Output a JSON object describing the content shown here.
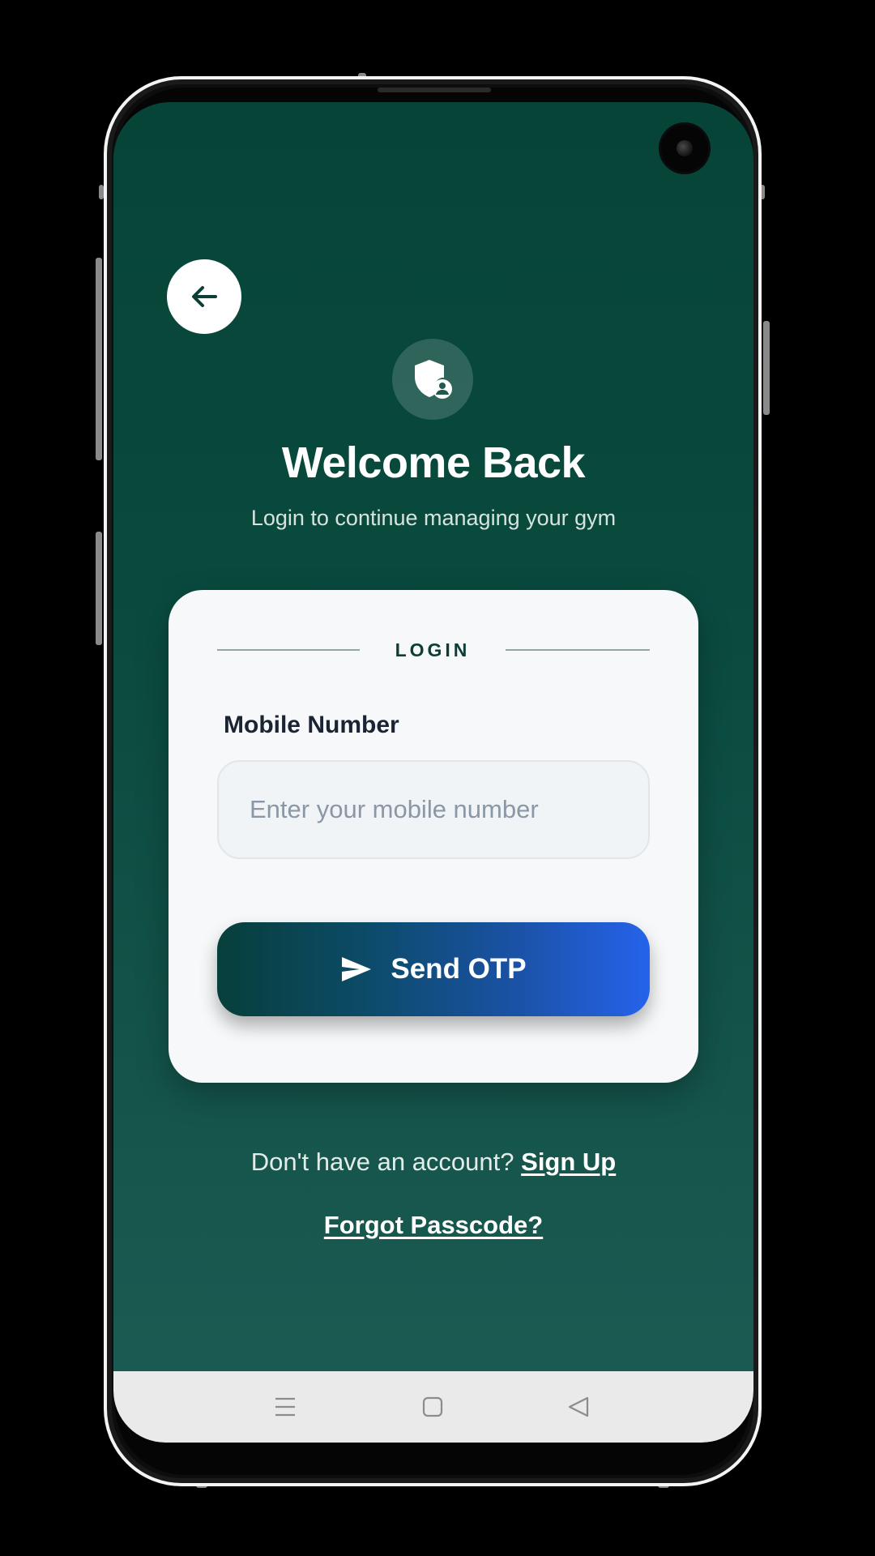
{
  "header": {
    "back_icon": "arrow-left-icon",
    "logo_icon": "shield-user-icon",
    "title": "Welcome Back",
    "subtitle": "Login to continue managing your gym"
  },
  "login_card": {
    "section_label": "LOGIN",
    "mobile_label": "Mobile Number",
    "mobile_placeholder": "Enter your mobile number",
    "mobile_value": "",
    "send_otp_label": "Send OTP",
    "send_icon": "send-icon"
  },
  "footer": {
    "no_account_text": "Don't have an account?",
    "signup_label": "Sign Up",
    "forgot_label": "Forgot Passcode?"
  },
  "nav_bar": {
    "items": [
      "recents-icon",
      "home-icon",
      "back-triangle-icon"
    ]
  },
  "colors": {
    "background_top": "#064437",
    "background_bottom": "#1c5c54",
    "card": "#f6f8f9",
    "button_gradient_start": "#073f3b",
    "button_gradient_end": "#2563eb",
    "heading": "#ffffff"
  }
}
